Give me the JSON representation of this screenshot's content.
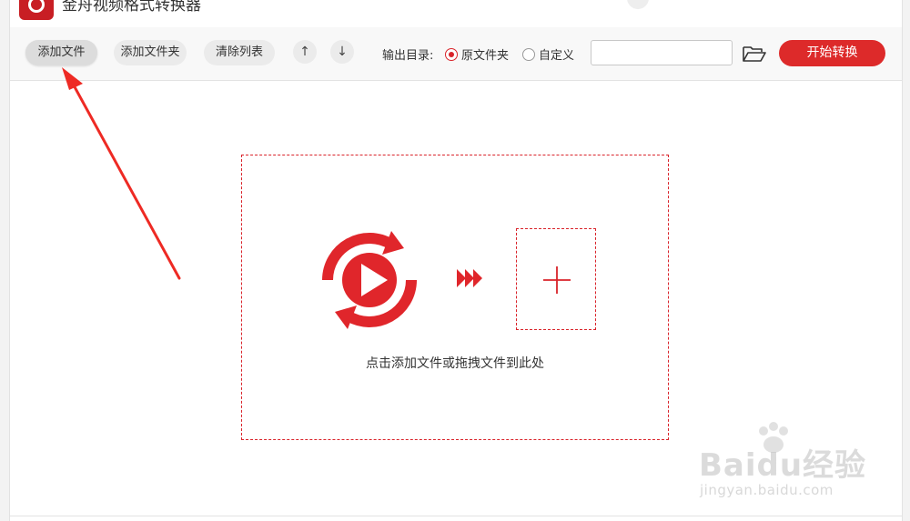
{
  "app": {
    "title": "金舟视频格式转换器"
  },
  "toolbar": {
    "add_file": "添加文件",
    "add_folder": "添加文件夹",
    "clear_list": "清除列表",
    "move_up_icon": "arrow-up",
    "move_down_icon": "arrow-down",
    "output_label": "输出目录:",
    "output_options": [
      "原文件夹",
      "自定义"
    ],
    "output_selected": "原文件夹",
    "output_path": "",
    "start_convert": "开始转换"
  },
  "main": {
    "drop_hint": "点击添加文件或拖拽文件到此处"
  },
  "watermark": {
    "brand": "Baidu经验",
    "url": "jingyan.baidu.com"
  },
  "colors": {
    "accent": "#dd2a2a",
    "dashed_border": "#d9232a",
    "annotation_arrow": "#ee2a24"
  }
}
